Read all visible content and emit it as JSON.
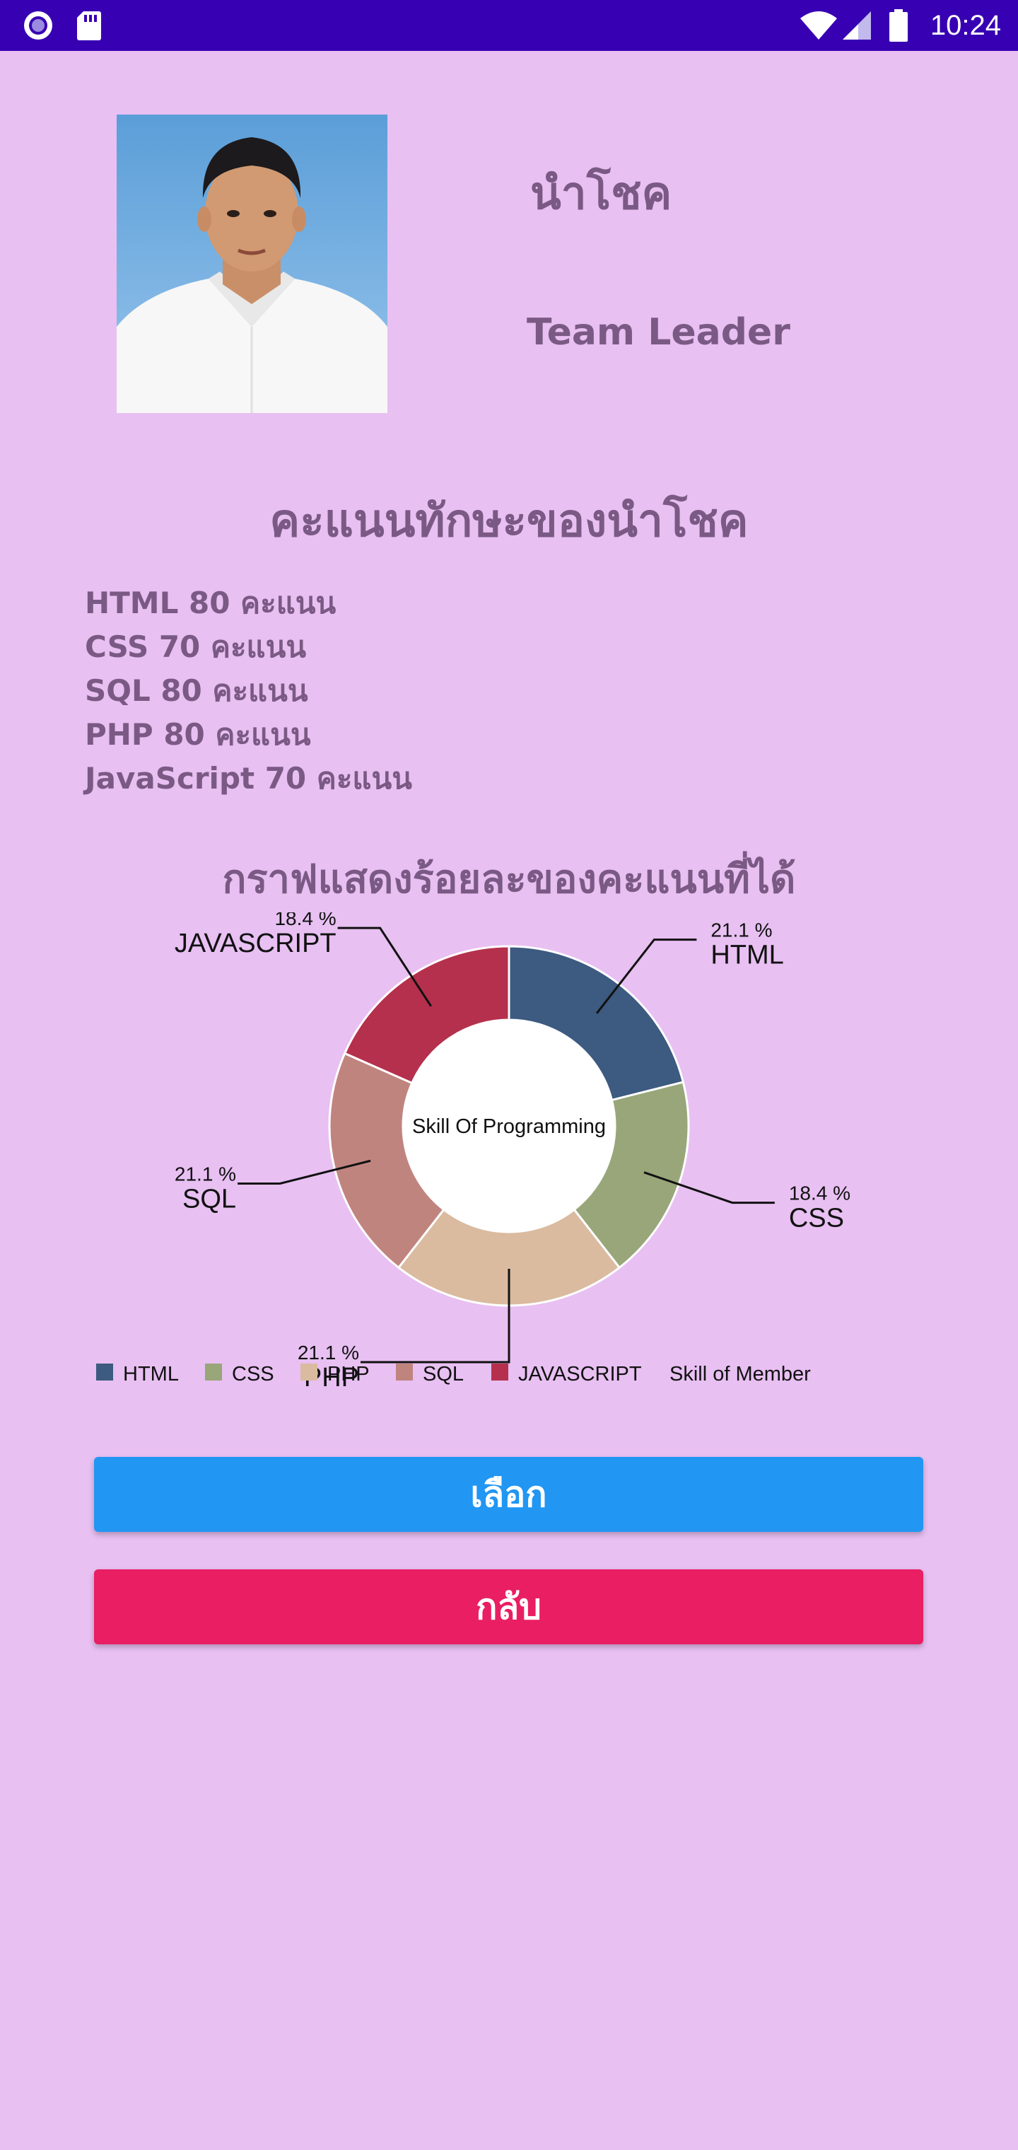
{
  "status_bar": {
    "time": "10:24",
    "icons": [
      "circle-notification-icon",
      "sd-card-icon",
      "wifi-icon",
      "signal-icon",
      "battery-icon"
    ],
    "background": "#3700b3"
  },
  "profile": {
    "name": "นำโชค",
    "role": "Team Leader"
  },
  "skills": {
    "title": "คะแนนทักษะของนำโชค",
    "items": [
      "HTML 80 คะแนน",
      "CSS 70 คะแนน",
      "SQL 80 คะแนน",
      "PHP 80 คะแนน",
      "JavaScript 70 คะแนน"
    ]
  },
  "graph_title": "กราฟแสดงร้อยละของคะแนนที่ได้",
  "chart_data": {
    "type": "pie",
    "donut": true,
    "center_text": "Skill Of Programming",
    "description": "Skill of Member",
    "categories": [
      "HTML",
      "CSS",
      "PHP",
      "SQL",
      "JAVASCRIPT"
    ],
    "values": [
      21.1,
      18.4,
      21.1,
      21.1,
      18.4
    ],
    "value_labels": [
      "21.1 %",
      "18.4 %",
      "21.1 %",
      "21.1 %",
      "18.4 %"
    ],
    "colors": [
      "#3d5a80",
      "#98a67a",
      "#dabba0",
      "#c0847f",
      "#b5304c"
    ],
    "legend_position": "bottom-left"
  },
  "buttons": {
    "select_label": "เลือก",
    "back_label": "กลับ"
  }
}
